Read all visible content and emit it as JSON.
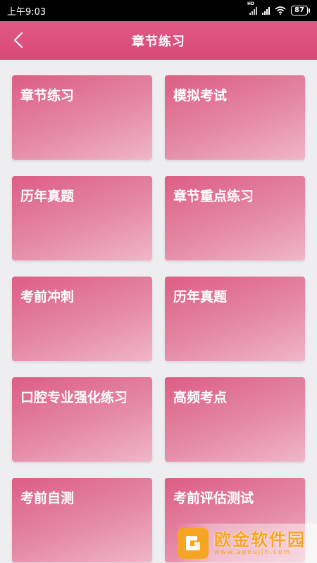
{
  "status_bar": {
    "time": "上午9:03",
    "network_badge": "HD",
    "battery": "87",
    "icons": [
      "signal-icon",
      "wifi-icon",
      "battery-icon"
    ]
  },
  "header": {
    "title": "章节练习",
    "back_icon": "chevron-left-icon",
    "color": "#dd5079"
  },
  "cards": [
    {
      "label": "章节练习"
    },
    {
      "label": "模拟考试"
    },
    {
      "label": "历年真题"
    },
    {
      "label": "章节重点练习"
    },
    {
      "label": "考前冲刺"
    },
    {
      "label": "历年真题"
    },
    {
      "label": "口腔专业强化练习"
    },
    {
      "label": "高频考点"
    },
    {
      "label": "考前自测"
    },
    {
      "label": "考前评估测试"
    }
  ],
  "watermark": {
    "name": "欧金软件园",
    "url": "www.apoujin.com",
    "color": "#f5a522"
  }
}
